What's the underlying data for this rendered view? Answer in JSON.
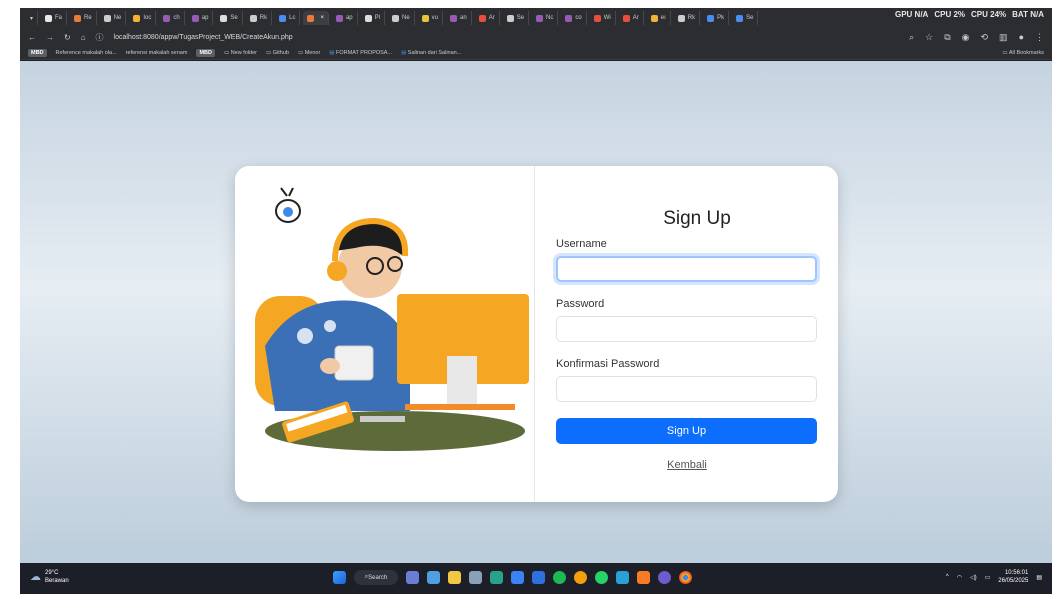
{
  "browser": {
    "tabs": [
      "Fa",
      "Re",
      "Ne",
      "Ioc",
      "ch",
      "ap",
      "Se",
      "Rk",
      "Lc",
      "",
      "ap",
      "Pl",
      "Ne",
      "vu",
      "an",
      "Ar",
      "Se",
      "Nc",
      "co",
      "Wi",
      "Ar",
      "eı",
      "Rk",
      "Pk",
      "Se"
    ],
    "address": "localhost:8080/appw/TugasProject_WEB/CreateAkun.php",
    "sysstat": [
      "GPU N/A",
      "CPU 2%",
      "CPU 24%",
      "BAT N/A"
    ],
    "bookmarks": [
      "Reference makalah ola...",
      "referensi makalah senam",
      "New folder",
      "Github",
      "Menor",
      "FORMAT PROPOSA...",
      "Salinan dari Salinan..."
    ],
    "bookmark_badge": "MBD",
    "all_bookmarks": "All Bookmarks"
  },
  "form": {
    "title": "Sign Up",
    "username_label": "Username",
    "password_label": "Password",
    "confirm_label": "Konfirmasi Password",
    "submit": "Sign Up",
    "back": "Kembali"
  },
  "taskbar": {
    "temp": "29°C",
    "weather": "Berawan",
    "search": "Search",
    "time": "10:56:01",
    "date": "26/05/2025"
  },
  "colors": {
    "primary": "#0d6efd",
    "illus_orange": "#f5a623",
    "illus_blue": "#3b6fb6"
  }
}
